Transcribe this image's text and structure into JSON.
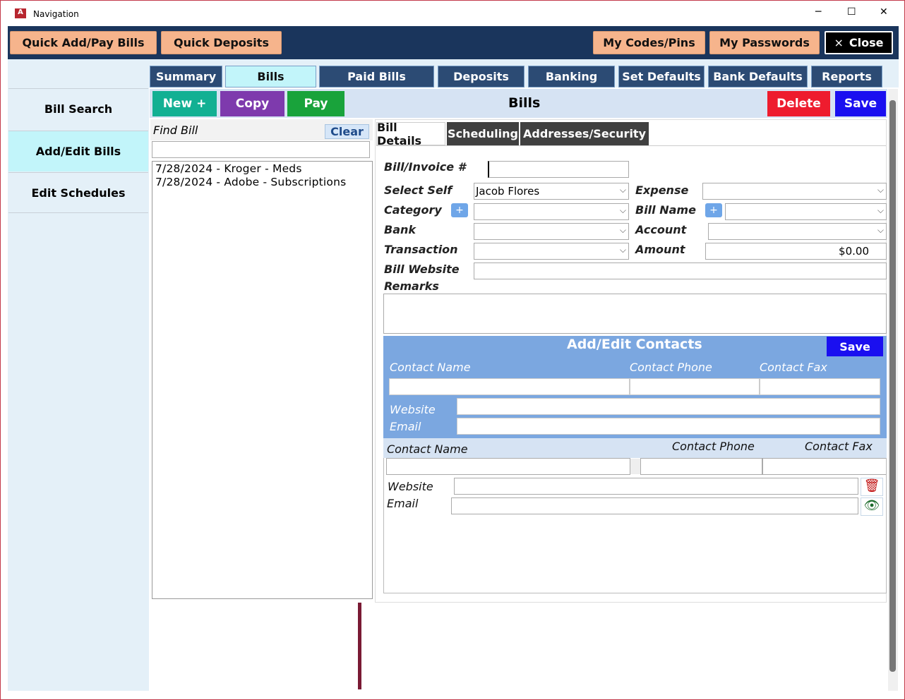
{
  "window": {
    "title": "Navigation",
    "minimize": "─",
    "maximize": "☐",
    "close": "✕"
  },
  "header": {
    "quick_add": "Quick Add/Pay Bills",
    "quick_deposits": "Quick Deposits",
    "my_codes": "My Codes/Pins",
    "my_passwords": "My Passwords",
    "close": "Close",
    "close_icon": "×"
  },
  "tabs": [
    "Summary",
    "Bills",
    "Paid Bills",
    "Deposits",
    "Banking",
    "Set Defaults",
    "Bank Defaults",
    "Reports"
  ],
  "sidebar": [
    "Bill Search",
    "Add/Edit Bills",
    "Edit Schedules"
  ],
  "toolbar": {
    "new": "New +",
    "copy": "Copy",
    "pay": "Pay",
    "title": "Bills",
    "delete": "Delete",
    "save": "Save"
  },
  "find": {
    "label": "Find Bill",
    "clear": "Clear",
    "value": "",
    "results": [
      "7/28/2024 - Kroger - Meds",
      "7/28/2024 - Adobe - Subscriptions"
    ]
  },
  "subtabs": [
    "Bill Details",
    "Scheduling",
    "Addresses/Security"
  ],
  "form": {
    "invoice_label": "Bill/Invoice #",
    "invoice": "",
    "self_label": "Select Self",
    "self": "Jacob Flores",
    "category_label": "Category",
    "bank_label": "Bank",
    "transaction_label": "Transaction",
    "website_label": "Bill Website",
    "remarks_label": "Remarks",
    "expense_label": "Expense",
    "billname_label": "Bill Name",
    "account_label": "Account",
    "amount_label": "Amount",
    "amount": "$0.00",
    "plus": "+"
  },
  "contacts": {
    "title": "Add/Edit Contacts",
    "save": "Save",
    "name": "Contact Name",
    "phone": "Contact Phone",
    "fax": "Contact Fax",
    "website": "Website",
    "email": "Email"
  },
  "list": {
    "name": "Contact Name",
    "phone": "Contact Phone",
    "fax": "Contact Fax",
    "website": "Website",
    "email": "Email"
  },
  "colors": {
    "header": "#1a355c",
    "orange": "#f6b48c",
    "new": "#12b093",
    "copy": "#7e3aad",
    "pay": "#19a33b",
    "delete": "#ee1c2e",
    "save": "#1a0ff0",
    "contacts": "#7ba7e0"
  }
}
